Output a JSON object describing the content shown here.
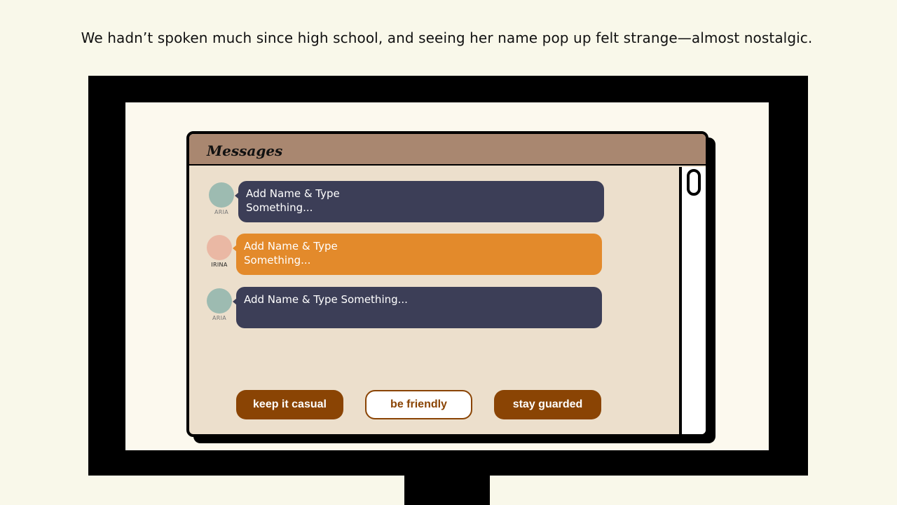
{
  "narration": "We hadn’t spoken much since high school, and seeing her name pop up felt strange—almost nostalgic.",
  "window": {
    "title": "Messages"
  },
  "messages": [
    {
      "sender": "ARIA",
      "text_line1": "Add Name & Type",
      "text_line2": "Something...",
      "avatar_color": "#9dbbb1",
      "bubble_color": "#3c3e57",
      "name_color": "#777777"
    },
    {
      "sender": "IRINA",
      "text_line1": "Add Name & Type",
      "text_line2": "Something...",
      "avatar_color": "#eab8a4",
      "bubble_color": "#e38a2b",
      "name_color": "#222222"
    },
    {
      "sender": "ARIA",
      "text_line1": "Add Name & Type Something...",
      "text_line2": "",
      "avatar_color": "#9dbbb1",
      "bubble_color": "#3c3e57",
      "name_color": "#777777"
    }
  ],
  "choices": [
    {
      "label": "keep it casual",
      "style": "filled"
    },
    {
      "label": "be friendly",
      "style": "outline"
    },
    {
      "label": "stay guarded",
      "style": "filled"
    }
  ],
  "colors": {
    "page_background": "#f9f8ea",
    "window_header": "#a98770",
    "window_body": "#ecdfcc",
    "choice_accent": "#8a4404"
  },
  "icons": {
    "scrollbar": "scroll-thumb"
  }
}
